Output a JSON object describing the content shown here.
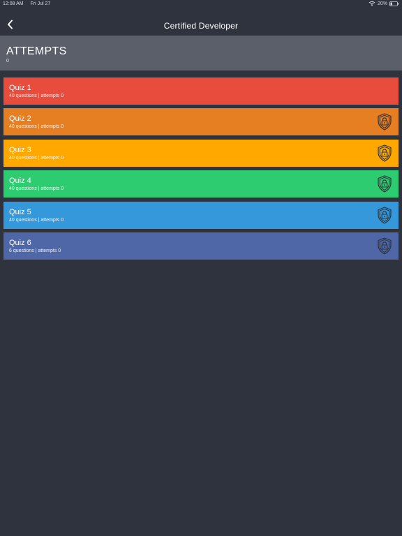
{
  "status_bar": {
    "time": "12:08 AM",
    "date": "Fri Jul 27",
    "battery": "20%",
    "icons": [
      "wifi-icon",
      "battery-icon"
    ]
  },
  "nav": {
    "title": "Certified Developer",
    "back_icon": "chevron-left-icon"
  },
  "summary": {
    "label": "ATTEMPTS",
    "value": "0"
  },
  "quizzes": [
    {
      "title": "Quiz 1",
      "subtitle": "40 questions | attempts 0",
      "color": "#e74c3c",
      "locked": false
    },
    {
      "title": "Quiz 2",
      "subtitle": "40 questions | attempts 0",
      "color": "#e67e22",
      "locked": true
    },
    {
      "title": "Quiz 3",
      "subtitle": "40 questions | attempts 0",
      "color": "#ffa800",
      "locked": true
    },
    {
      "title": "Quiz 4",
      "subtitle": "40 questions | attempts 0",
      "color": "#2ecc71",
      "locked": true
    },
    {
      "title": "Quiz 5",
      "subtitle": "40 questions | attempts 0",
      "color": "#3498db",
      "locked": true
    },
    {
      "title": "Quiz 6",
      "subtitle": "6 questions | attempts 0",
      "color": "#4f67a6",
      "locked": true
    }
  ],
  "colors": {
    "background": "#2e333d",
    "summary_background": "#5a5f69",
    "icon_stroke": "#2b2f37"
  }
}
